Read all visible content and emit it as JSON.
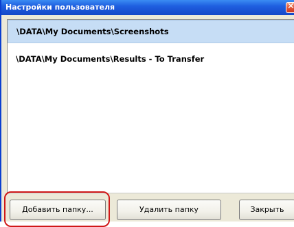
{
  "window": {
    "title": "Настройки пользователя",
    "close_glyph": "✕",
    "titlebar_color": "#1f5fe0",
    "close_color": "#e0563a"
  },
  "folders": {
    "items": [
      {
        "path": "\\DATA\\My Documents\\Screenshots",
        "selected": true
      },
      {
        "path": "\\DATA\\My Documents\\Results - To Transfer",
        "selected": false
      }
    ],
    "selected_color": "#c6ddf5"
  },
  "buttons": {
    "add_folder": "Добавить папку...",
    "remove_folder": "Удалить папку",
    "close": "Закрыть"
  },
  "annotation": {
    "highlight_color": "#d01818"
  }
}
